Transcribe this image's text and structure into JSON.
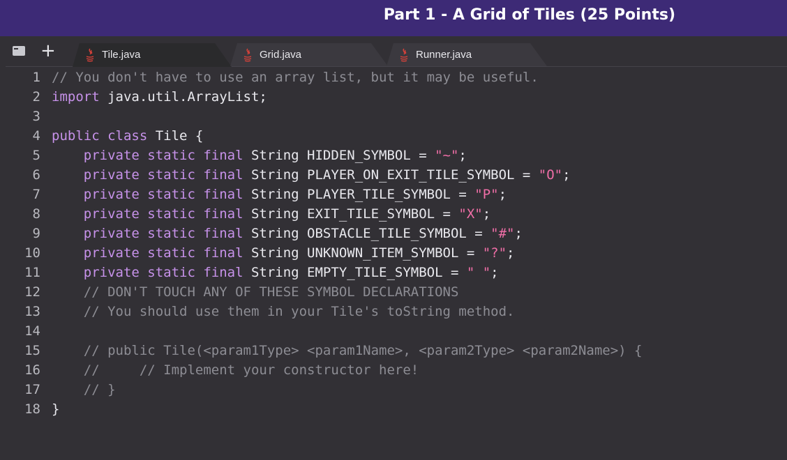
{
  "banner": {
    "title": "Part 1 - A Grid of Tiles (25 Points)"
  },
  "tabs": [
    {
      "label": "Tile.java",
      "active": true
    },
    {
      "label": "Grid.java",
      "active": false
    },
    {
      "label": "Runner.java",
      "active": false
    }
  ],
  "colors": {
    "banner": "#3d2a76",
    "editor_bg": "#323035",
    "keyword": "#c792ea",
    "comment": "#8d8d94",
    "string": "#f06ea7",
    "java_icon": "#e0433a"
  },
  "icons": [
    "files-icon",
    "plus-icon",
    "java-icon"
  ],
  "code": {
    "lines": [
      {
        "num": "1",
        "tokens": [
          {
            "t": "// You don't have to use an array list, but it may be useful.",
            "c": "cm"
          }
        ]
      },
      {
        "num": "2",
        "tokens": [
          {
            "t": "import",
            "c": "kw"
          },
          {
            "t": " java.util.ArrayList;",
            "c": ""
          }
        ]
      },
      {
        "num": "3",
        "tokens": []
      },
      {
        "num": "4",
        "tokens": [
          {
            "t": "public",
            "c": "kw"
          },
          {
            "t": " ",
            "c": ""
          },
          {
            "t": "class",
            "c": "kw"
          },
          {
            "t": " Tile {",
            "c": ""
          }
        ]
      },
      {
        "num": "5",
        "tokens": [
          {
            "t": "    ",
            "c": ""
          },
          {
            "t": "private static final",
            "c": "kw"
          },
          {
            "t": " String HIDDEN_SYMBOL = ",
            "c": ""
          },
          {
            "t": "\"~\"",
            "c": "st"
          },
          {
            "t": ";",
            "c": ""
          }
        ]
      },
      {
        "num": "6",
        "tokens": [
          {
            "t": "    ",
            "c": ""
          },
          {
            "t": "private static final",
            "c": "kw"
          },
          {
            "t": " String PLAYER_ON_EXIT_TILE_SYMBOL = ",
            "c": ""
          },
          {
            "t": "\"O\"",
            "c": "st"
          },
          {
            "t": ";",
            "c": ""
          }
        ]
      },
      {
        "num": "7",
        "tokens": [
          {
            "t": "    ",
            "c": ""
          },
          {
            "t": "private static final",
            "c": "kw"
          },
          {
            "t": " String PLAYER_TILE_SYMBOL = ",
            "c": ""
          },
          {
            "t": "\"P\"",
            "c": "st"
          },
          {
            "t": ";",
            "c": ""
          }
        ]
      },
      {
        "num": "8",
        "tokens": [
          {
            "t": "    ",
            "c": ""
          },
          {
            "t": "private static final",
            "c": "kw"
          },
          {
            "t": " String EXIT_TILE_SYMBOL = ",
            "c": ""
          },
          {
            "t": "\"X\"",
            "c": "st"
          },
          {
            "t": ";",
            "c": ""
          }
        ]
      },
      {
        "num": "9",
        "tokens": [
          {
            "t": "    ",
            "c": ""
          },
          {
            "t": "private static final",
            "c": "kw"
          },
          {
            "t": " String OBSTACLE_TILE_SYMBOL = ",
            "c": ""
          },
          {
            "t": "\"#\"",
            "c": "st"
          },
          {
            "t": ";",
            "c": ""
          }
        ]
      },
      {
        "num": "10",
        "tokens": [
          {
            "t": "    ",
            "c": ""
          },
          {
            "t": "private static final",
            "c": "kw"
          },
          {
            "t": " String UNKNOWN_ITEM_SYMBOL = ",
            "c": ""
          },
          {
            "t": "\"?\"",
            "c": "st"
          },
          {
            "t": ";",
            "c": ""
          }
        ]
      },
      {
        "num": "11",
        "tokens": [
          {
            "t": "    ",
            "c": ""
          },
          {
            "t": "private static final",
            "c": "kw"
          },
          {
            "t": " String EMPTY_TILE_SYMBOL = ",
            "c": ""
          },
          {
            "t": "\" \"",
            "c": "st"
          },
          {
            "t": ";",
            "c": ""
          }
        ]
      },
      {
        "num": "12",
        "tokens": [
          {
            "t": "    ",
            "c": ""
          },
          {
            "t": "// DON'T TOUCH ANY OF THESE SYMBOL DECLARATIONS",
            "c": "cm"
          }
        ]
      },
      {
        "num": "13",
        "tokens": [
          {
            "t": "    ",
            "c": ""
          },
          {
            "t": "// You should use them in your Tile's toString method.",
            "c": "cm"
          }
        ]
      },
      {
        "num": "14",
        "tokens": []
      },
      {
        "num": "15",
        "tokens": [
          {
            "t": "    ",
            "c": ""
          },
          {
            "t": "// public Tile(<param1Type> <param1Name>, <param2Type> <param2Name>) {",
            "c": "cm"
          }
        ]
      },
      {
        "num": "16",
        "tokens": [
          {
            "t": "    ",
            "c": ""
          },
          {
            "t": "//     // Implement your constructor here!",
            "c": "cm"
          }
        ]
      },
      {
        "num": "17",
        "tokens": [
          {
            "t": "    ",
            "c": ""
          },
          {
            "t": "// }",
            "c": "cm"
          }
        ]
      },
      {
        "num": "18",
        "tokens": [
          {
            "t": "}",
            "c": ""
          }
        ]
      }
    ]
  }
}
